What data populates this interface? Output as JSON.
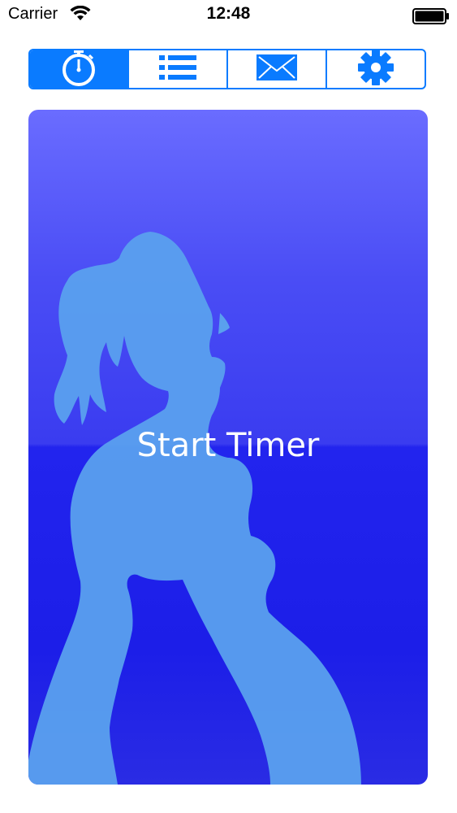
{
  "status_bar": {
    "carrier": "Carrier",
    "time": "12:48",
    "wifi_icon": "wifi-icon",
    "battery_icon": "battery-full-icon"
  },
  "tabs": [
    {
      "icon": "stopwatch-icon",
      "selected": true
    },
    {
      "icon": "list-icon",
      "selected": false
    },
    {
      "icon": "envelope-icon",
      "selected": false
    },
    {
      "icon": "gear-icon",
      "selected": false
    }
  ],
  "timer": {
    "label": "Start Timer",
    "illustration": "pregnant-woman-silhouette"
  },
  "colors": {
    "accent": "#0a7bff",
    "panel_top": "#6a6cff",
    "panel_bottom": "#1c1ee8",
    "silhouette": "#5aa0ee"
  }
}
